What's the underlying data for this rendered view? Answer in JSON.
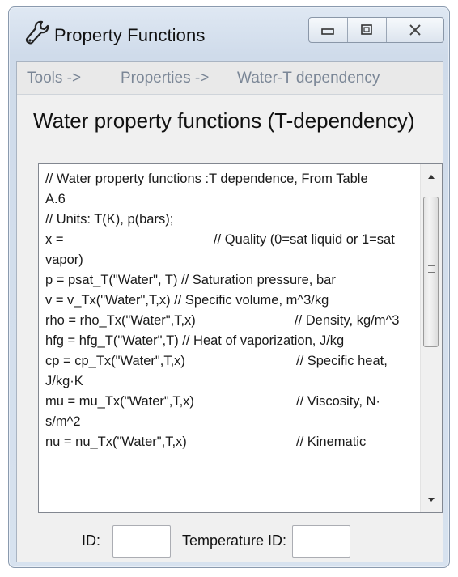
{
  "window": {
    "title": "Property Functions",
    "icon": "wrench-icon",
    "buttons": [
      "minimize",
      "maximize",
      "close"
    ]
  },
  "breadcrumb": {
    "items": [
      "Tools ->",
      "Properties ->",
      "Water-T dependency"
    ]
  },
  "page": {
    "title": "Water property functions (T-dependency)"
  },
  "editor": {
    "lines": [
      "// Water property functions :T dependence, From Table",
      "A.6",
      "// Units: T(K), p(bars);",
      "x =",
      "// Quality (0=sat liquid or 1=sat",
      "vapor)",
      "p = psat_T(\"Water\", T)  // Saturation pressure, bar",
      "v = v_Tx(\"Water\",T,x)   // Specific volume, m^3/kg",
      "rho = rho_Tx(\"Water\",T,x)",
      "// Density, kg/m^3",
      "hfg = hfg_T(\"Water\",T)  // Heat of vaporization, J/kg",
      "cp = cp_Tx(\"Water\",T,x)",
      "// Specific heat,",
      "J/kg·K",
      "mu = mu_Tx(\"Water\",T,x)",
      "// Viscosity, N·",
      "s/m^2",
      "nu = nu_Tx(\"Water\",T,x)",
      "// Kinematic"
    ]
  },
  "footer": {
    "id_label": "ID:",
    "id_value": "",
    "temp_label": "Temperature ID:",
    "temp_value": ""
  },
  "colors": {
    "window_frame": "#cfdbea",
    "breadcrumb_text": "#7a8696",
    "client_bg": "#f0f0f0"
  }
}
